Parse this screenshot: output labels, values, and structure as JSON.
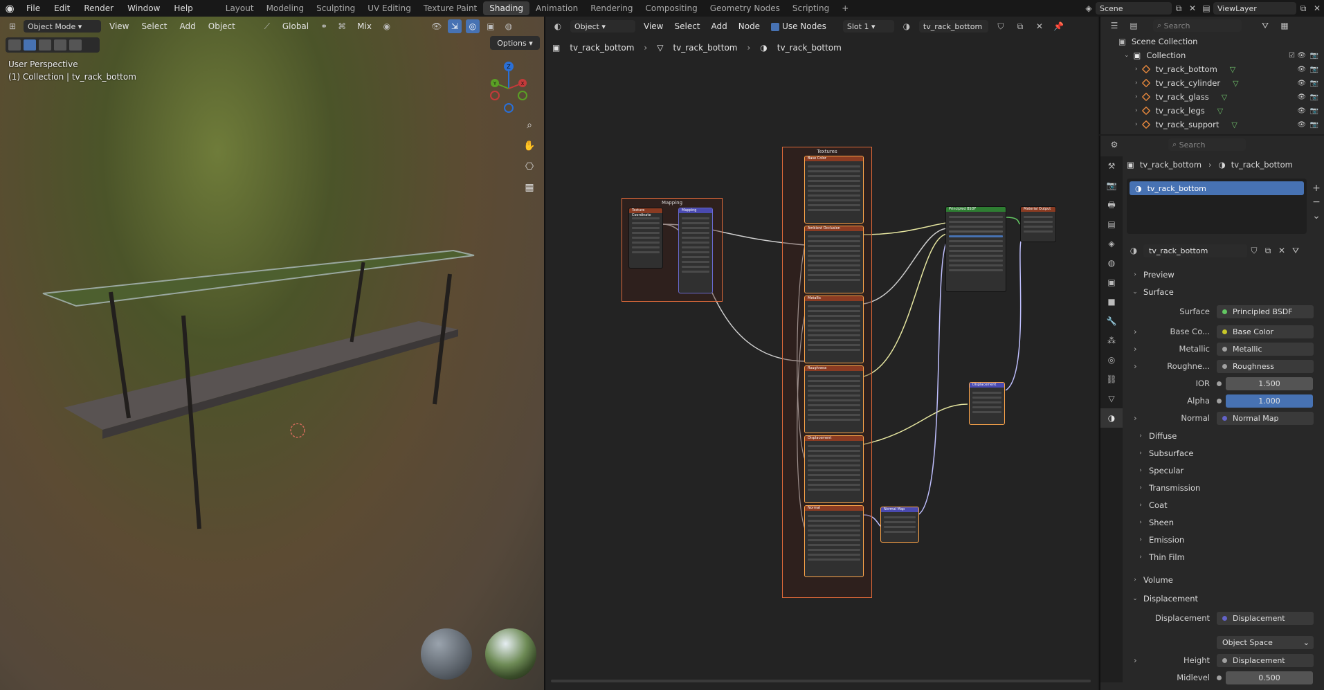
{
  "topbar": {
    "menu": [
      "File",
      "Edit",
      "Render",
      "Window",
      "Help"
    ],
    "tabs": [
      "Layout",
      "Modeling",
      "Sculpting",
      "UV Editing",
      "Texture Paint",
      "Shading",
      "Animation",
      "Rendering",
      "Compositing",
      "Geometry Nodes",
      "Scripting"
    ],
    "active_tab": "Shading",
    "scene": "Scene",
    "view_layer": "ViewLayer"
  },
  "viewport": {
    "mode": "Object Mode",
    "menu": [
      "View",
      "Select",
      "Add",
      "Object"
    ],
    "transform_orientation": "Global",
    "snap_mode": "Mix",
    "options_label": "Options",
    "info_line1": "User Perspective",
    "info_line2": "(1) Collection | tv_rack_bottom",
    "gizmo": {
      "z": "Z",
      "y": "Y",
      "x": "X"
    }
  },
  "node_editor": {
    "object_label": "Object",
    "menu": [
      "View",
      "Select",
      "Add",
      "Node"
    ],
    "use_nodes_label": "Use Nodes",
    "slot": "Slot 1",
    "material": "tv_rack_bottom",
    "breadcrumb": [
      "tv_rack_bottom",
      "tv_rack_bottom",
      "tv_rack_bottom"
    ],
    "frames": {
      "mapping": "Mapping",
      "textures": "Textures"
    },
    "nodes": {
      "tex_coord": "Texture Coordinate",
      "mapping": "Mapping",
      "base_color": "Base Color",
      "ambient": "Ambient Occlusion",
      "metallic": "Metallic",
      "roughness": "Roughness",
      "displacement": "Displacement",
      "normal": "Normal",
      "bsdf": "Principled BSDF",
      "output": "Material Output",
      "disp_node": "Displacement",
      "normal_map": "Normal Map"
    }
  },
  "outliner": {
    "search_placeholder": "Search",
    "scene_collection": "Scene Collection",
    "collection": "Collection",
    "items": [
      "tv_rack_bottom",
      "tv_rack_cylinder",
      "tv_rack_glass",
      "tv_rack_legs",
      "tv_rack_support"
    ]
  },
  "properties": {
    "search_placeholder": "Search",
    "breadcrumb": [
      "tv_rack_bottom",
      "tv_rack_bottom"
    ],
    "material_slot": "tv_rack_bottom",
    "material_name": "tv_rack_bottom",
    "sections": {
      "preview": "Preview",
      "surface": "Surface",
      "volume": "Volume",
      "displacement": "Displacement"
    },
    "surface": {
      "surface_label": "Surface",
      "surface_value": "Principled BSDF",
      "base_color_label": "Base Co...",
      "base_color_value": "Base Color",
      "metallic_label": "Metallic",
      "metallic_value": "Metallic",
      "roughness_label": "Roughne...",
      "roughness_value": "Roughness",
      "ior_label": "IOR",
      "ior_value": "1.500",
      "alpha_label": "Alpha",
      "alpha_value": "1.000",
      "normal_label": "Normal",
      "normal_value": "Normal Map"
    },
    "subsections": [
      "Diffuse",
      "Subsurface",
      "Specular",
      "Transmission",
      "Coat",
      "Sheen",
      "Emission",
      "Thin Film"
    ],
    "displacement": {
      "disp_label": "Displacement",
      "disp_value": "Displacement",
      "space": "Object Space",
      "height_label": "Height",
      "height_value": "Displacement",
      "midlevel_label": "Midlevel",
      "midlevel_value": "0.500"
    },
    "colors": {
      "accent": "#4772b3",
      "yellow_socket": "#c7c729",
      "purple_socket": "#6363c7",
      "grey_socket": "#a1a1a1",
      "green_socket": "#63c763"
    }
  }
}
